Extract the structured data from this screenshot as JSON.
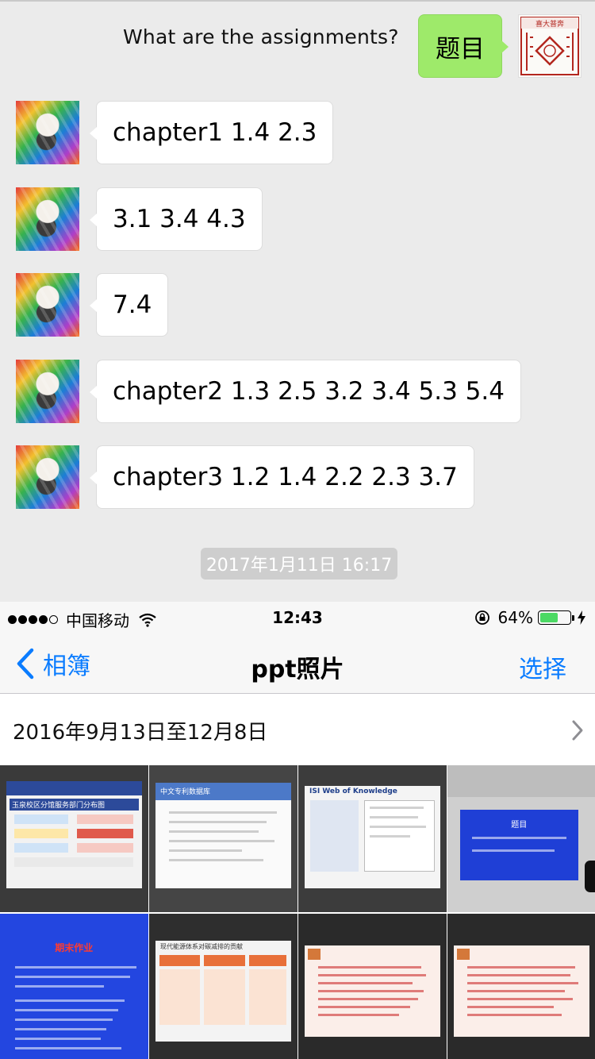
{
  "chat": {
    "outgoing": {
      "caption": "What are the assignments?",
      "bubble_text": "题目",
      "avatar_seal_text": "喜大普奔"
    },
    "incoming": [
      {
        "text": "chapter1 1.4 2.3"
      },
      {
        "text": "3.1 3.4 4.3"
      },
      {
        "text": "7.4"
      },
      {
        "text": "chapter2 1.3 2.5 3.2 3.4 5.3 5.4"
      },
      {
        "text": "chapter3 1.2 1.4 2.2 2.3 3.7"
      }
    ],
    "timestamp": "2017年1月11日 16:17"
  },
  "photos_screenshot": {
    "status_bar": {
      "carrier": "中国移动",
      "time": "12:43",
      "battery_percent_text": "64%",
      "battery_level": 0.64
    },
    "nav": {
      "back_label": "相簿",
      "title": "ppt照片",
      "select_label": "选择"
    },
    "section": {
      "date_range": "2016年9月13日至12月8日"
    },
    "thumbnails": [
      {
        "title": "玉泉校区分馆服务部门分布图"
      },
      {
        "title": "中文专利数据库"
      },
      {
        "title": "ISI Web of Knowledge"
      },
      {
        "title": "题目"
      },
      {
        "title": "期末作业"
      },
      {
        "title": "现代能源体系对碳减排的贡献"
      },
      {
        "title": ""
      },
      {
        "title": ""
      }
    ]
  },
  "colors": {
    "chat_background": "#ebebeb",
    "outgoing_bubble": "#9eea6a",
    "incoming_bubble": "#ffffff",
    "ios_blue": "#0a7cff",
    "battery_green": "#4cd964"
  }
}
